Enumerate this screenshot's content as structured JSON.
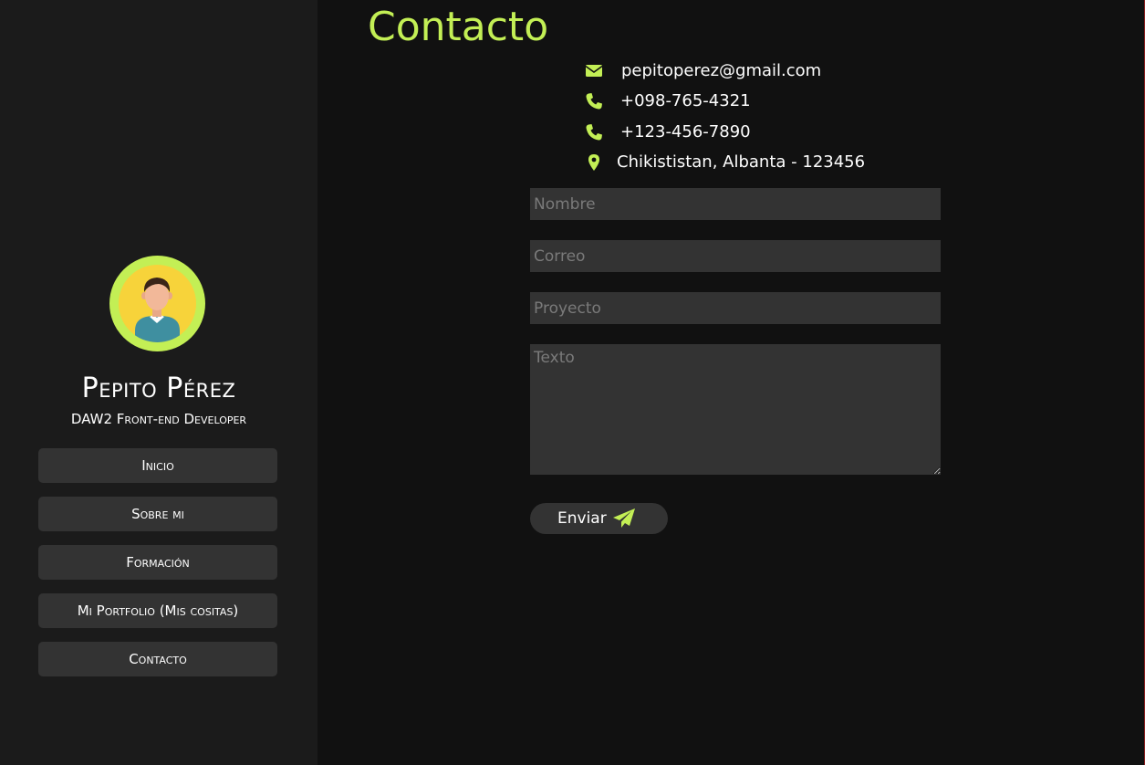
{
  "colors": {
    "accent": "#c3ef55",
    "background": "#111111",
    "sidebar": "#1b1b1b",
    "control": "#333333",
    "avatar_bg": "#f7d33a"
  },
  "sidebar": {
    "avatar_icon": "user-avatar-icon",
    "name": "Pepito Pérez",
    "role": "DAW2 Front-end Developer",
    "nav": [
      {
        "label": "Inicio"
      },
      {
        "label": "Sobre mi"
      },
      {
        "label": "Formación"
      },
      {
        "label": "Mi Portfolio (Mis cositas)"
      },
      {
        "label": "Contacto"
      }
    ]
  },
  "main": {
    "title": "Contacto",
    "contact": {
      "email": {
        "icon": "envelope-icon",
        "text": "pepitoperez@gmail.com"
      },
      "phone1": {
        "icon": "phone-icon",
        "text": "+098-765-4321"
      },
      "phone2": {
        "icon": "phone-icon",
        "text": "+123-456-7890"
      },
      "address": {
        "icon": "map-marker-icon",
        "text": "Chikististan, Albanta - 123456"
      }
    },
    "form": {
      "name_placeholder": "Nombre",
      "email_placeholder": "Correo",
      "project_placeholder": "Proyecto",
      "text_placeholder": "Texto",
      "submit_label": "Enviar",
      "submit_icon": "paper-plane-icon"
    }
  }
}
